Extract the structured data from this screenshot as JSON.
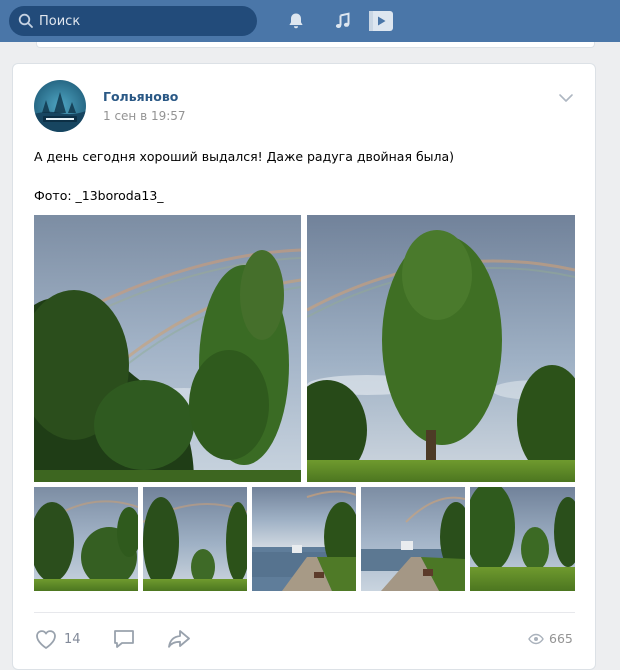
{
  "topbar": {
    "search_placeholder": "Поиск",
    "icons": [
      "search-icon",
      "bell-icon",
      "music-icon",
      "video-icon"
    ],
    "colors": {
      "bar": "#4a76a8",
      "search_bg": "#224b7a"
    }
  },
  "post": {
    "author": "Гольяново",
    "date": "1 сен в 19:57",
    "text": "А день сегодня хороший выдался! Даже радуга двойная была)",
    "photo_credit": "Фото: _13boroda13_",
    "photos_count_visible": 7,
    "actions": {
      "likes": "14",
      "views": "665",
      "icons": [
        "heart-icon",
        "comment-icon",
        "share-icon",
        "eye-icon"
      ]
    },
    "colors": {
      "author": "#2a5885",
      "meta": "#939393",
      "action": "#828a99"
    }
  }
}
